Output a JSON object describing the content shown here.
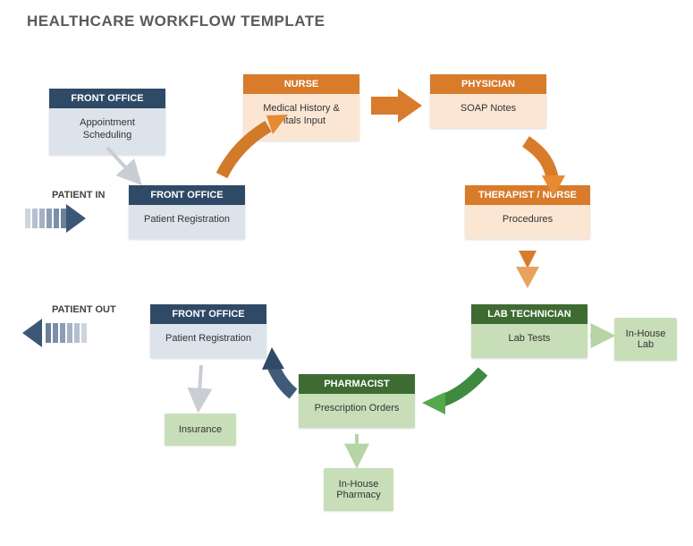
{
  "title": "HEALTHCARE WORKFLOW TEMPLATE",
  "labels": {
    "patient_in": "PATIENT IN",
    "patient_out": "PATIENT OUT"
  },
  "nodes": {
    "fo_appt": {
      "head": "FRONT OFFICE",
      "body": "Appointment Scheduling"
    },
    "fo_reg1": {
      "head": "FRONT OFFICE",
      "body": "Patient Registration"
    },
    "nurse": {
      "head": "NURSE",
      "body": "Medical History & Vitals Input"
    },
    "physician": {
      "head": "PHYSICIAN",
      "body": "SOAP Notes"
    },
    "therapist": {
      "head": "THERAPIST / NURSE",
      "body": "Procedures"
    },
    "labtech": {
      "head": "LAB TECHNICIAN",
      "body": "Lab Tests"
    },
    "pharmacist": {
      "head": "PHARMACIST",
      "body": "Prescription Orders"
    },
    "fo_reg2": {
      "head": "FRONT OFFICE",
      "body": "Patient Registration"
    }
  },
  "subnodes": {
    "inhouse_lab": "In-House Lab",
    "inhouse_pharmacy": "In-House Pharmacy",
    "insurance": "Insurance"
  }
}
